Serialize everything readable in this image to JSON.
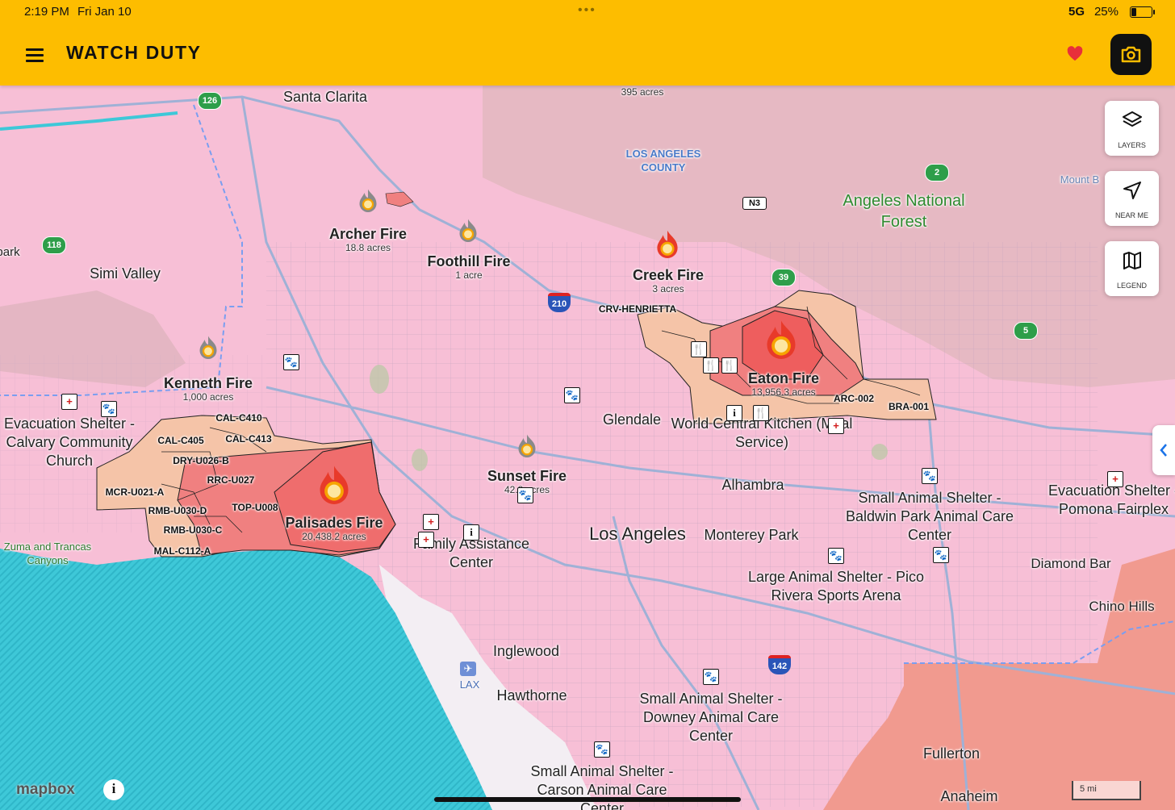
{
  "status_bar": {
    "time": "2:19 PM",
    "date": "Fri Jan 10",
    "signal": "5G",
    "battery": "25%"
  },
  "app": {
    "title": "WATCH DUTY"
  },
  "header_icons": [
    "menu-icon",
    "heart-icon",
    "camera-icon"
  ],
  "map_controls": {
    "layers_label": "LAYERS",
    "near_me_label": "NEAR ME",
    "legend_label": "LEGEND"
  },
  "fires": [
    {
      "name": "Archer Fire",
      "acres": "18.8 acres",
      "status": "contained"
    },
    {
      "name": "Foothill Fire",
      "acres": "1 acre",
      "status": "contained"
    },
    {
      "name": "Creek Fire",
      "acres": "3 acres",
      "status": "active"
    },
    {
      "name": "Kenneth Fire",
      "acres": "1,000 acres",
      "status": "contained"
    },
    {
      "name": "Eaton Fire",
      "acres": "13,956.3 acres",
      "status": "active"
    },
    {
      "name": "Palisades Fire",
      "acres": "20,438.2 acres",
      "status": "active"
    },
    {
      "name": "Sunset Fire",
      "acres": "42.8 acres",
      "status": "contained"
    }
  ],
  "unnamed_fire_marker": {
    "acres": "395 acres"
  },
  "places": [
    "Santa Clarita",
    "Simi Valley",
    "park",
    "Glendale",
    "Alhambra",
    "Los Angeles",
    "Monterey Park",
    "Inglewood",
    "Hawthorne",
    "Diamond Bar",
    "Chino Hills",
    "Fullerton",
    "Anaheim",
    "LAX",
    "Mount B",
    "Zuma and Trancas Canyons"
  ],
  "regions": {
    "county": "LOS ANGELES COUNTY",
    "forest": "Angeles National Forest"
  },
  "zones": [
    "CAL-C410",
    "CAL-C405",
    "CAL-C413",
    "DRY-U026-B",
    "RRC-U027",
    "MCR-U021-A",
    "TOP-U008",
    "RMB-U030-D",
    "RMB-U030-C",
    "MAL-C112-A",
    "CRV-HENRIETTA",
    "ARC-002",
    "BRA-001"
  ],
  "shelters": [
    {
      "name": "Evacuation Shelter - Calvary Community Church",
      "type": "evacuation"
    },
    {
      "name": "World Central Kitchen (Meal Service)",
      "type": "food"
    },
    {
      "name": "Family Assistance Center",
      "type": "info"
    },
    {
      "name": "Small Animal Shelter - Baldwin Park Animal Care Center",
      "type": "animal"
    },
    {
      "name": "Evacuation Shelter - Pomona Fairplex",
      "type": "evacuation"
    },
    {
      "name": "Large Animal Shelter - Pico Rivera Sports Arena",
      "type": "animal"
    },
    {
      "name": "Small Animal Shelter - Downey Animal Care Center",
      "type": "animal"
    },
    {
      "name": "Small Animal Shelter - Carson Animal Care Center",
      "type": "animal"
    }
  ],
  "highways": [
    "126",
    "118",
    "N3",
    "210",
    "2",
    "39",
    "5",
    "142"
  ],
  "attribution": "mapbox",
  "scale": "5 mi",
  "colors": {
    "brand_yellow": "#fdbd00",
    "evacuation_order": "#f08080",
    "evacuation_warning": "#f5c4a8",
    "ocean": "#3ec8d8",
    "fire_active": "#e83a2a",
    "fire_contained": "#8a8a8a"
  }
}
